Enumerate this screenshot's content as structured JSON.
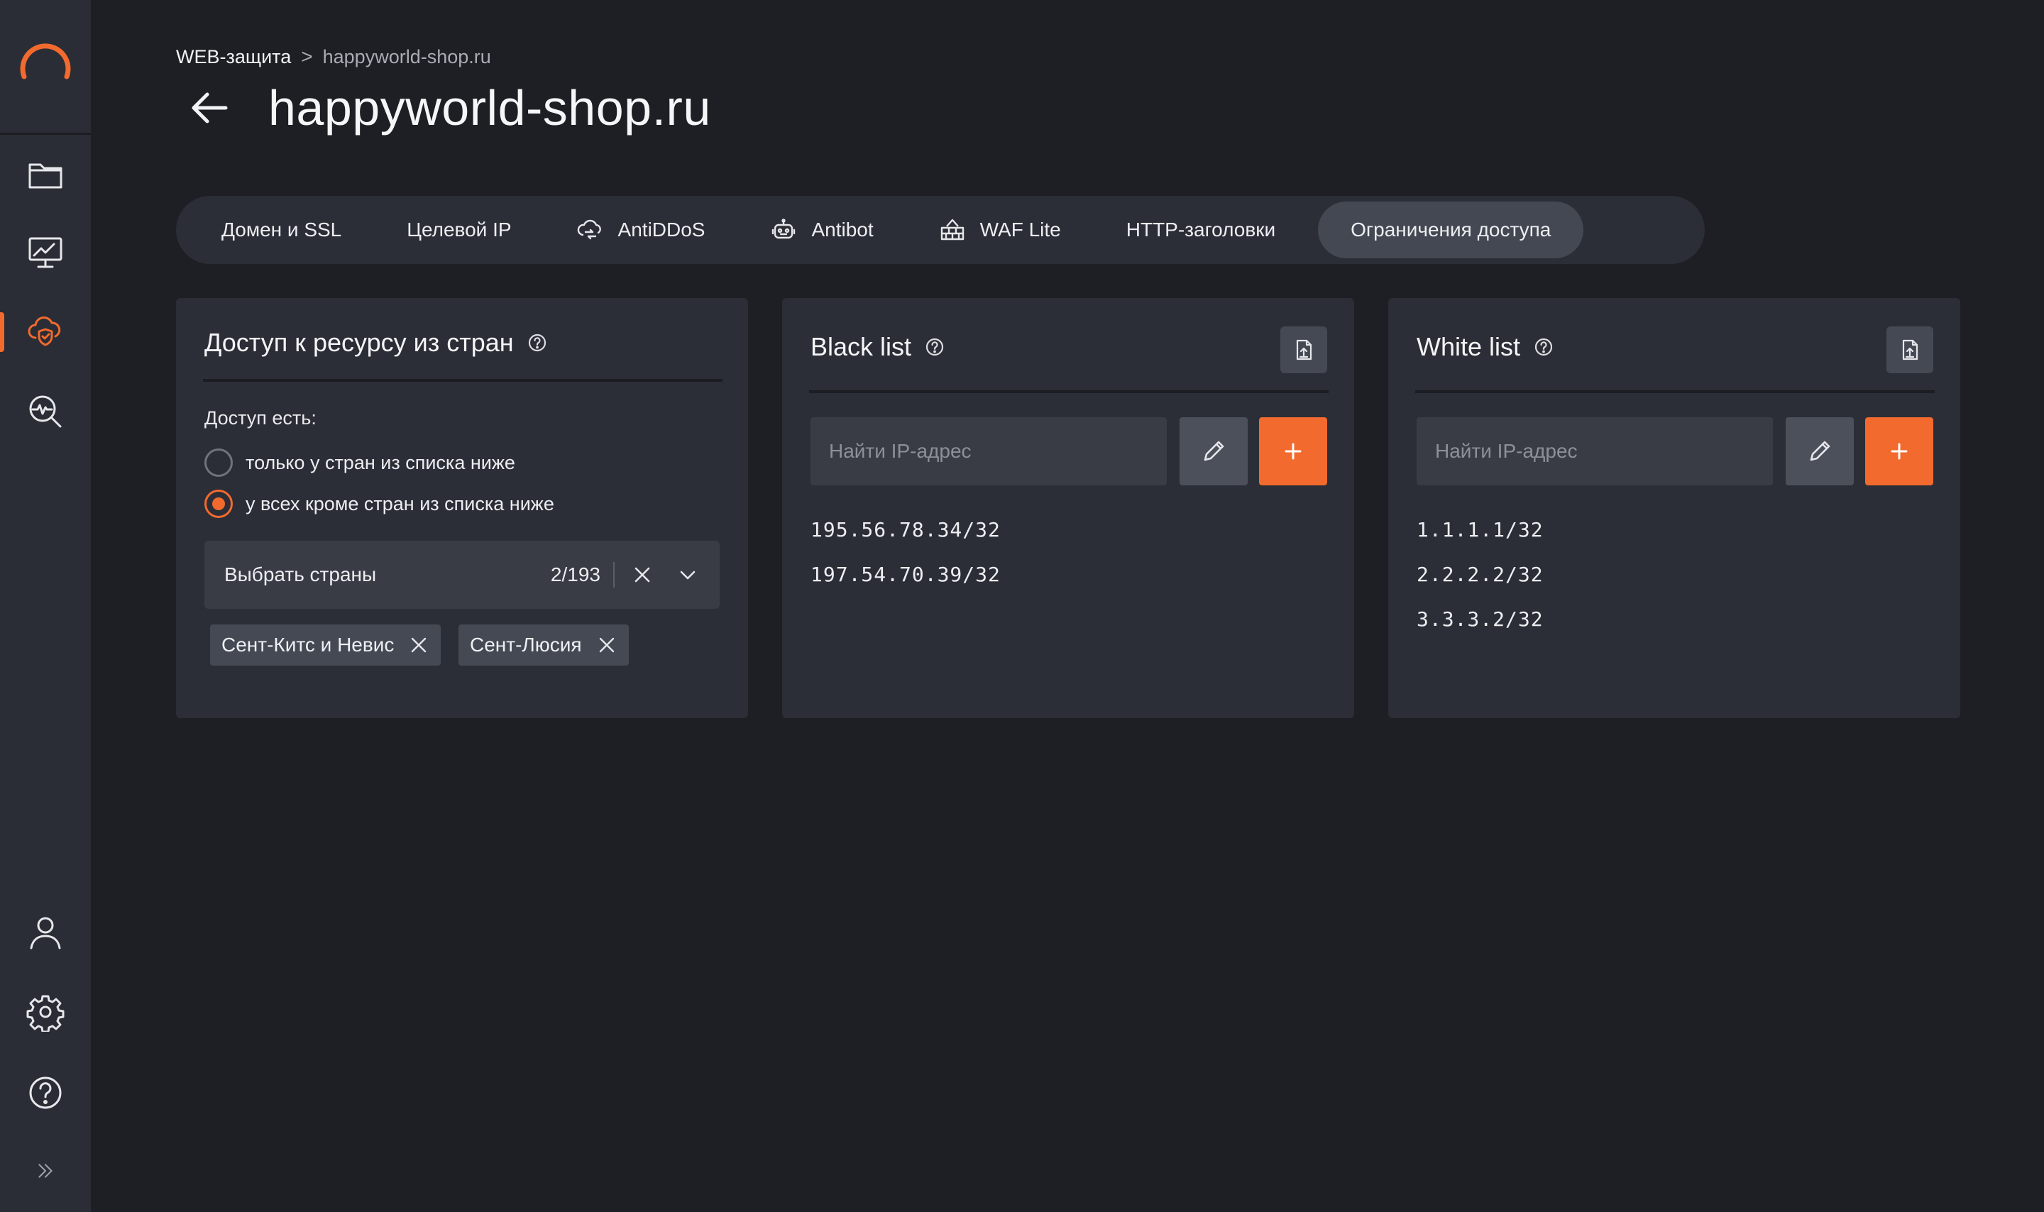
{
  "colors": {
    "accent": "#f26a2e",
    "background": "#1e1f24",
    "panel": "#2b2e36"
  },
  "sidebar": {
    "logo": "logo-ring-icon",
    "items": [
      {
        "icon": "folder-icon",
        "active": false
      },
      {
        "icon": "monitor-chart-icon",
        "active": false
      },
      {
        "icon": "cloud-shield-icon",
        "active": true
      },
      {
        "icon": "search-pulse-icon",
        "active": false
      }
    ],
    "bottom_items": [
      {
        "icon": "user-icon"
      },
      {
        "icon": "gear-icon"
      },
      {
        "icon": "help-icon"
      },
      {
        "icon": "double-chevron-right-icon"
      }
    ]
  },
  "breadcrumb": {
    "items": [
      "WEB-защита",
      "happyworld-shop.ru"
    ],
    "separator": ">"
  },
  "page": {
    "title": "happyworld-shop.ru"
  },
  "tabs": [
    {
      "label": "Домен и SSL",
      "icon": null,
      "active": false
    },
    {
      "label": "Целевой IP",
      "icon": null,
      "active": false
    },
    {
      "label": "AntiDDoS",
      "icon": "antiddos-icon",
      "active": false
    },
    {
      "label": "Antibot",
      "icon": "robot-icon",
      "active": false
    },
    {
      "label": "WAF Lite",
      "icon": "firewall-icon",
      "active": false
    },
    {
      "label": "HTTP-заголовки",
      "icon": null,
      "active": false
    },
    {
      "label": "Ограничения доступа",
      "icon": null,
      "active": true
    }
  ],
  "geo": {
    "title": "Доступ к ресурсу из стран",
    "access_label": "Доступ есть:",
    "options": [
      {
        "label": "только у стран из списка ниже",
        "checked": false
      },
      {
        "label": "у всех кроме стран из списка ниже",
        "checked": true
      }
    ],
    "select": {
      "placeholder": "Выбрать страны",
      "count": "2/193"
    },
    "chips": [
      "Сент-Китс и Невис",
      "Сент-Люсия"
    ]
  },
  "blacklist": {
    "title": "Black list",
    "search_placeholder": "Найти IP-адрес",
    "ips": [
      "195.56.78.34/32",
      "197.54.70.39/32"
    ]
  },
  "whitelist": {
    "title": "White list",
    "search_placeholder": "Найти IP-адрес",
    "ips": [
      "1.1.1.1/32",
      "2.2.2.2/32",
      "3.3.3.2/32"
    ]
  }
}
